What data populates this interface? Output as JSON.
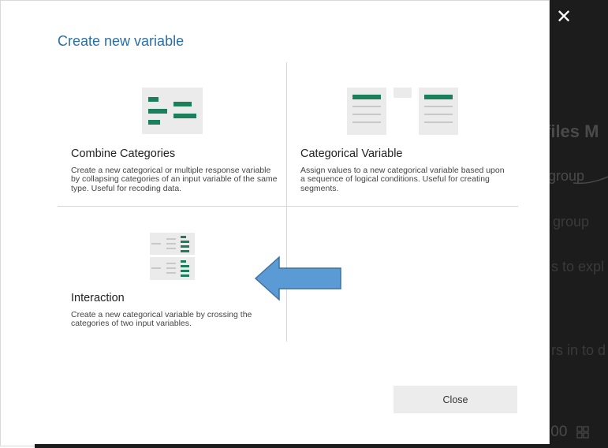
{
  "dialog": {
    "title": "Create new variable",
    "close_label": "Close",
    "options": [
      {
        "title": "Combine Categories",
        "description": "Create a new categorical or multiple response variable by collapsing categories of an input variable of the same type. Useful for recoding data.",
        "icon": "combine-categories-icon"
      },
      {
        "title": "Categorical Variable",
        "description": "Assign values to a new categorical variable based upon a sequence of logical conditions. Useful for creating segments.",
        "icon": "categorical-variable-icon"
      },
      {
        "title": "Interaction",
        "description": "Create a new categorical variable by crossing the categories of two input variables.",
        "icon": "interaction-icon"
      }
    ]
  },
  "background": {
    "heading": "files M",
    "line1": "group",
    "line2": "group",
    "line3": "s to expl",
    "line4": "rs in to d",
    "footer": ".00"
  },
  "colors": {
    "accent_green": "#1a7f5a",
    "title_blue": "#2a6fa8",
    "arrow_blue": "#5b9bd5",
    "backdrop": "#1c1c1c"
  }
}
